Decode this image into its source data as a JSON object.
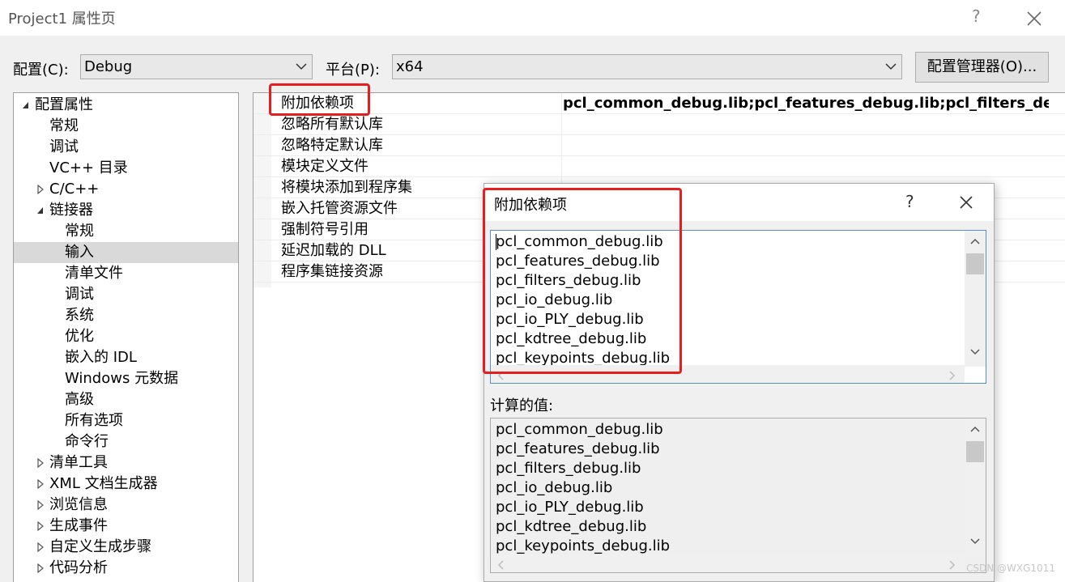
{
  "window": {
    "title": "Project1 属性页",
    "help": "?",
    "close_icon": "close-icon"
  },
  "config_bar": {
    "config_label": "配置(C):",
    "config_value": "Debug",
    "platform_label": "平台(P):",
    "platform_value": "x64",
    "manager_button": "配置管理器(O)..."
  },
  "tree": [
    {
      "label": "配置属性",
      "level": 0,
      "twisty": "expanded"
    },
    {
      "label": "常规",
      "level": 1,
      "twisty": "none"
    },
    {
      "label": "调试",
      "level": 1,
      "twisty": "none"
    },
    {
      "label": "VC++ 目录",
      "level": 1,
      "twisty": "none"
    },
    {
      "label": "C/C++",
      "level": 1,
      "twisty": "collapsed"
    },
    {
      "label": "链接器",
      "level": 1,
      "twisty": "expanded"
    },
    {
      "label": "常规",
      "level": 2,
      "twisty": "none"
    },
    {
      "label": "输入",
      "level": 2,
      "twisty": "none",
      "selected": true
    },
    {
      "label": "清单文件",
      "level": 2,
      "twisty": "none"
    },
    {
      "label": "调试",
      "level": 2,
      "twisty": "none"
    },
    {
      "label": "系统",
      "level": 2,
      "twisty": "none"
    },
    {
      "label": "优化",
      "level": 2,
      "twisty": "none"
    },
    {
      "label": "嵌入的 IDL",
      "level": 2,
      "twisty": "none"
    },
    {
      "label": "Windows 元数据",
      "level": 2,
      "twisty": "none"
    },
    {
      "label": "高级",
      "level": 2,
      "twisty": "none"
    },
    {
      "label": "所有选项",
      "level": 2,
      "twisty": "none"
    },
    {
      "label": "命令行",
      "level": 2,
      "twisty": "none"
    },
    {
      "label": "清单工具",
      "level": 1,
      "twisty": "collapsed"
    },
    {
      "label": "XML 文档生成器",
      "level": 1,
      "twisty": "collapsed"
    },
    {
      "label": "浏览信息",
      "level": 1,
      "twisty": "collapsed"
    },
    {
      "label": "生成事件",
      "level": 1,
      "twisty": "collapsed"
    },
    {
      "label": "自定义生成步骤",
      "level": 1,
      "twisty": "collapsed"
    },
    {
      "label": "代码分析",
      "level": 1,
      "twisty": "collapsed"
    }
  ],
  "properties": [
    {
      "name": "附加依赖项",
      "value": "pcl_common_debug.lib;pcl_features_debug.lib;pcl_filters_debug.lib;"
    },
    {
      "name": "忽略所有默认库",
      "value": ""
    },
    {
      "name": "忽略特定默认库",
      "value": ""
    },
    {
      "name": "模块定义文件",
      "value": ""
    },
    {
      "name": "将模块添加到程序集",
      "value": ""
    },
    {
      "name": "嵌入托管资源文件",
      "value": ""
    },
    {
      "name": "强制符号引用",
      "value": ""
    },
    {
      "name": "延迟加载的 DLL",
      "value": ""
    },
    {
      "name": "程序集链接资源",
      "value": ""
    }
  ],
  "dialog": {
    "title": "附加依赖项",
    "help": "?",
    "editable_lines": [
      "pcl_common_debug.lib",
      "pcl_features_debug.lib",
      "pcl_filters_debug.lib",
      "pcl_io_debug.lib",
      "pcl_io_PLY_debug.lib",
      "pcl_kdtree_debug.lib",
      "pcl_keypoints_debug.lib"
    ],
    "computed_label": "计算的值:",
    "computed_lines": [
      "pcl_common_debug.lib",
      "pcl_features_debug.lib",
      "pcl_filters_debug.lib",
      "pcl_io_debug.lib",
      "pcl_io_PLY_debug.lib",
      "pcl_kdtree_debug.lib",
      "pcl_keypoints_debug.lib"
    ]
  },
  "highlight_color": "#e81e1e",
  "watermark": "CSDN @WXG1011"
}
